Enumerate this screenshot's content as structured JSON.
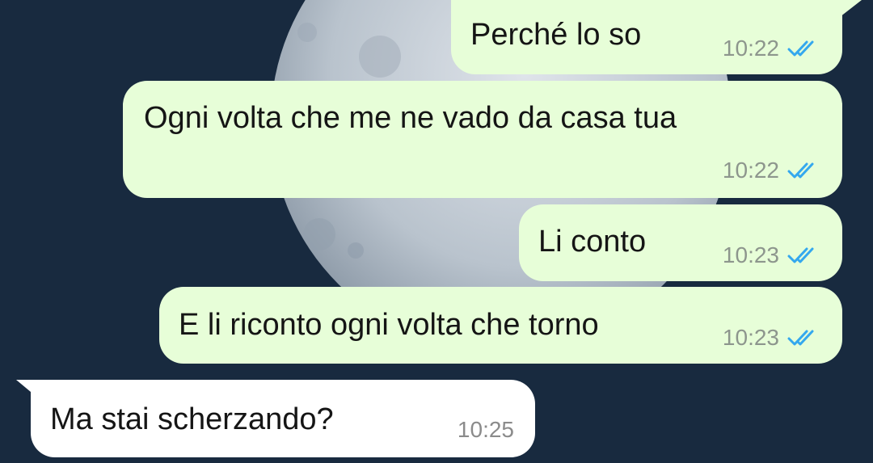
{
  "messages": [
    {
      "text": "Perché lo so",
      "time": "10:22",
      "direction": "outgoing",
      "status": "read"
    },
    {
      "text": "Ogni volta che me ne vado da casa tua",
      "time": "10:22",
      "direction": "outgoing",
      "status": "read"
    },
    {
      "text": "Li conto",
      "time": "10:23",
      "direction": "outgoing",
      "status": "read"
    },
    {
      "text": "E li riconto ogni volta che torno",
      "time": "10:23",
      "direction": "outgoing",
      "status": "read"
    },
    {
      "text": "Ma stai scherzando?",
      "time": "10:25",
      "direction": "incoming"
    }
  ],
  "colors": {
    "background": "#182a3f",
    "outgoing_bubble": "#e7fed8",
    "incoming_bubble": "#ffffff",
    "read_ticks": "#34a8ee"
  },
  "icons": {
    "read_receipt": "double-check-icon"
  }
}
